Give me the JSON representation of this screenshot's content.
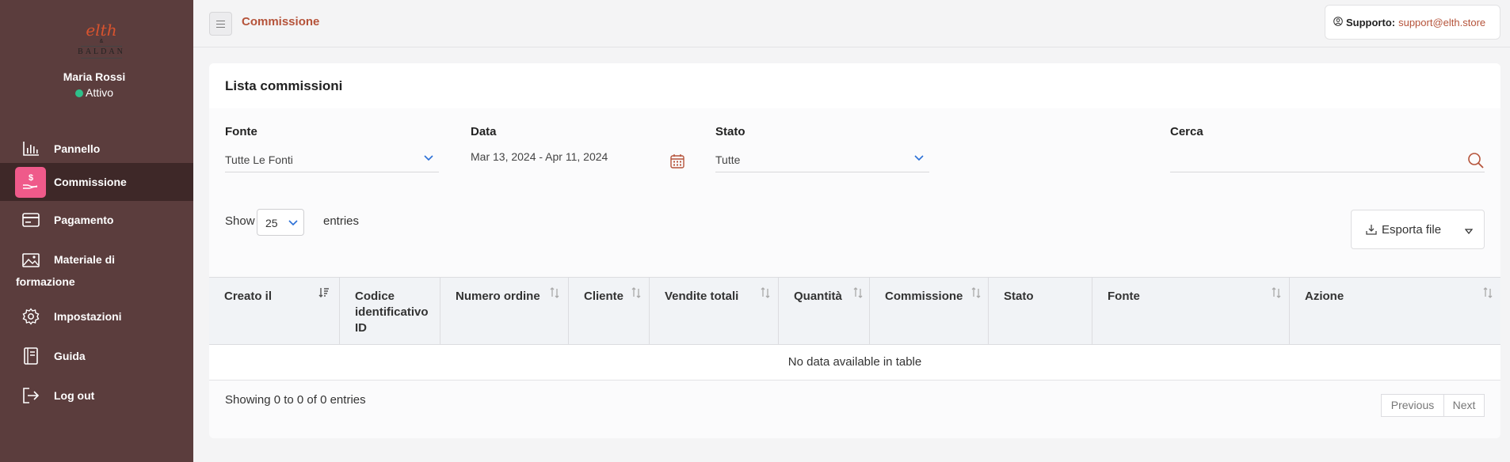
{
  "sidebar": {
    "logo": {
      "top": "elth",
      "amp": "&",
      "bottom": "BALDAN"
    },
    "user_name": "Maria Rossi",
    "user_status": "Attivo",
    "items": [
      {
        "label": "Pannello",
        "icon": "bar-chart-icon"
      },
      {
        "label": "Commissione",
        "icon": "money-hand-icon",
        "active": true
      },
      {
        "label": "Pagamento",
        "icon": "credit-card-icon"
      },
      {
        "label": "Materiale di formazione",
        "icon": "image-icon"
      },
      {
        "label": "Impostazioni",
        "icon": "gear-icon"
      },
      {
        "label": "Guida",
        "icon": "book-icon"
      },
      {
        "label": "Log out",
        "icon": "logout-icon"
      }
    ]
  },
  "topbar": {
    "title": "Commissione",
    "support_label": "Supporto:",
    "support_email": "support@elth.store"
  },
  "card": {
    "title": "Lista commissioni",
    "filters": {
      "fonte": {
        "label": "Fonte",
        "value": "Tutte Le Fonti"
      },
      "data": {
        "label": "Data",
        "value": "Mar 13, 2024 - Apr 11, 2024"
      },
      "stato": {
        "label": "Stato",
        "value": "Tutte"
      },
      "cerca": {
        "label": "Cerca",
        "value": ""
      }
    },
    "show_label": "Show",
    "page_size": "25",
    "entries_label": "entries",
    "export_label": "Esporta file"
  },
  "table": {
    "columns": [
      "Creato il",
      "Codice identificativo ID",
      "Numero ordine",
      "Cliente",
      "Vendite totali",
      "Quantità",
      "Commissione",
      "Stato",
      "Fonte",
      "Azione"
    ],
    "empty_message": "No data available in table",
    "info": "Showing 0 to 0 of 0 entries",
    "previous": "Previous",
    "next": "Next"
  },
  "colors": {
    "sidebar": "#5b3d3d",
    "sidebar_active": "#3e2828",
    "accent": "#b5533a",
    "active_icon_bg": "#ef5a8a",
    "status_green": "#2ec08a"
  }
}
